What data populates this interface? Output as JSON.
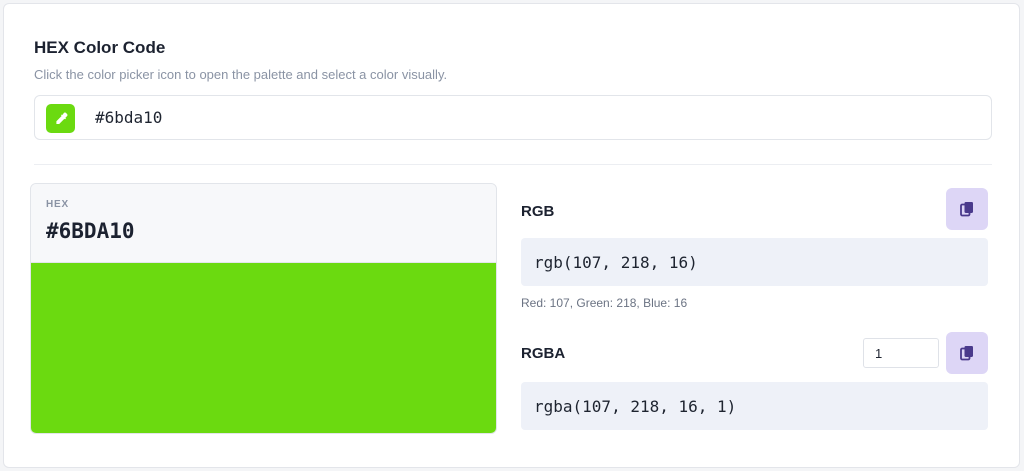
{
  "header": {
    "title": "HEX Color Code",
    "subtitle": "Click the color picker icon to open the palette and select a color visually."
  },
  "hex_input": {
    "value": "#6bda10",
    "picker_icon": "eyedropper-icon"
  },
  "swatch": {
    "label": "HEX",
    "value": "#6BDA10",
    "color": "#6bda10"
  },
  "rgb": {
    "label": "RGB",
    "value": "rgb(107, 218, 16)",
    "breakdown": "Red: 107, Green: 218, Blue: 16",
    "copy_icon": "copy-icon"
  },
  "rgba": {
    "label": "RGBA",
    "alpha": "1",
    "value": "rgba(107, 218, 16, 1)",
    "copy_icon": "copy-icon"
  },
  "colors": {
    "accent": "#6bda10",
    "copy_button_bg": "#ddd6f6",
    "copy_icon": "#4a3a8c"
  }
}
